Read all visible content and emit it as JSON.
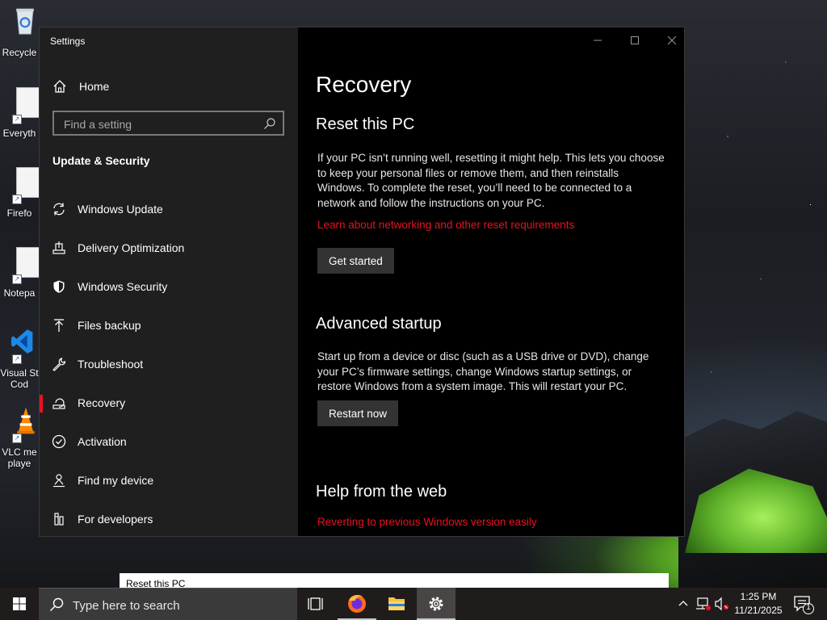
{
  "desktop": {
    "icons": [
      {
        "label": "Recycle",
        "icon": "recycle-bin-icon"
      },
      {
        "label": "Everyth",
        "icon": "everything-icon"
      },
      {
        "label": "Firefo",
        "icon": "firefox-shortcut-icon"
      },
      {
        "label": "Notepa",
        "icon": "notepad-icon"
      },
      {
        "label": "Visual St",
        "label2": "Cod",
        "icon": "vscode-icon"
      },
      {
        "label": "VLC me",
        "label2": "playe",
        "icon": "vlc-icon"
      }
    ]
  },
  "window": {
    "title": "Settings",
    "controls": {
      "minimize": "minimize-icon",
      "maximize": "maximize-icon",
      "close": "close-icon"
    }
  },
  "sidebar": {
    "home_label": "Home",
    "search_placeholder": "Find a setting",
    "section_title": "Update & Security",
    "items": [
      {
        "label": "Windows Update",
        "icon": "sync-icon"
      },
      {
        "label": "Delivery Optimization",
        "icon": "delivery-icon"
      },
      {
        "label": "Windows Security",
        "icon": "shield-icon"
      },
      {
        "label": "Files backup",
        "icon": "backup-arrow-icon"
      },
      {
        "label": "Troubleshoot",
        "icon": "wrench-icon"
      },
      {
        "label": "Recovery",
        "icon": "recovery-icon",
        "active": true
      },
      {
        "label": "Activation",
        "icon": "check-circle-icon"
      },
      {
        "label": "Find my device",
        "icon": "person-pin-icon"
      },
      {
        "label": "For developers",
        "icon": "developer-icon"
      }
    ]
  },
  "content": {
    "page_title": "Recovery",
    "reset": {
      "heading": "Reset this PC",
      "description": "If your PC isn’t running well, resetting it might help. This lets you choose to keep your personal files or remove them, and then reinstalls Windows. To complete the reset, you’ll need to be connected to a network and follow the instructions on your PC.",
      "link": "Learn about networking and other reset requirements",
      "button": "Get started"
    },
    "advanced": {
      "heading": "Advanced startup",
      "description": "Start up from a device or disc (such as a USB drive or DVD), change your PC’s firmware settings, change Windows startup settings, or restore Windows from a system image. This will restart your PC.",
      "button": "Restart now"
    },
    "help": {
      "heading": "Help from the web",
      "link": "Reverting to previous Windows version easily"
    }
  },
  "preview_strip": {
    "text": "Reset this PC"
  },
  "taskbar": {
    "search_placeholder": "Type here to search",
    "apps": [
      {
        "name": "task-view-icon"
      },
      {
        "name": "firefox-icon"
      },
      {
        "name": "file-explorer-icon"
      },
      {
        "name": "settings-gear-icon",
        "active": true
      }
    ],
    "time": "1:25 PM",
    "date": "11/21/2025",
    "notification_count": "1"
  },
  "colors": {
    "accent": "#e81123",
    "sidebar_bg": "#1f1f1f",
    "content_bg": "#000000",
    "taskbar_bg": "#211c1c"
  }
}
